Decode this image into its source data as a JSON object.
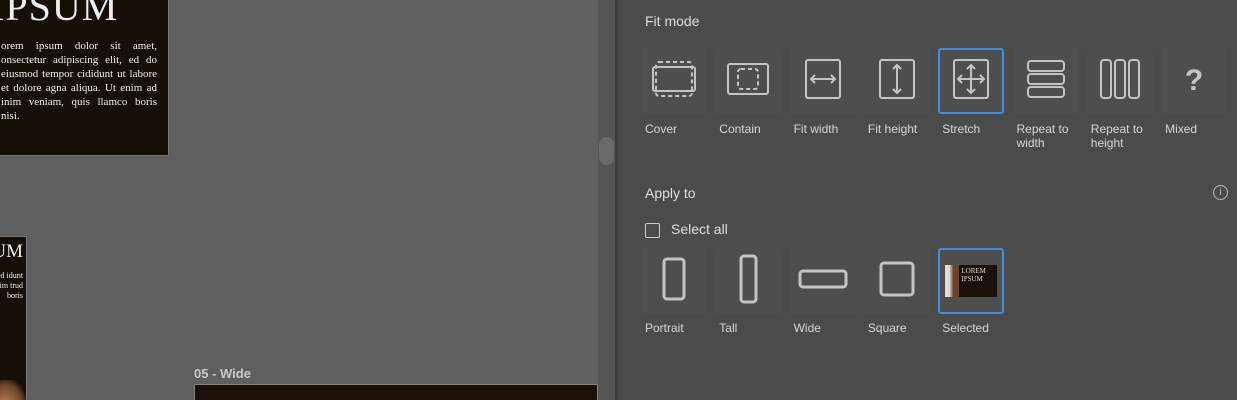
{
  "canvas": {
    "card1": {
      "title": "IPSUM",
      "body": "orem ipsum dolor sit amet, onsectetur adipiscing elit, ed do eiusmod tempor cididunt ut labore et dolore agna aliqua. Ut enim ad inim veniam, quis llamco boris nisi."
    },
    "card2": {
      "title": "UM",
      "body": "met, , sed idunt agna inim trud boris"
    },
    "wide_label": "05 - Wide"
  },
  "panel": {
    "fit_mode": {
      "heading": "Fit mode",
      "options": [
        {
          "label": "Cover",
          "icon": "cover-icon",
          "selected": false
        },
        {
          "label": "Contain",
          "icon": "contain-icon",
          "selected": false
        },
        {
          "label": "Fit width",
          "icon": "fit-width-icon",
          "selected": false
        },
        {
          "label": "Fit height",
          "icon": "fit-height-icon",
          "selected": false
        },
        {
          "label": "Stretch",
          "icon": "stretch-icon",
          "selected": true
        },
        {
          "label": "Repeat to width",
          "icon": "repeat-width-icon",
          "selected": false
        },
        {
          "label": "Repeat to height",
          "icon": "repeat-height-icon",
          "selected": false
        },
        {
          "label": "Mixed",
          "icon": "question-icon",
          "selected": false
        }
      ]
    },
    "apply_to": {
      "heading": "Apply to",
      "select_all": "Select all",
      "select_all_checked": false,
      "options": [
        {
          "label": "Portrait",
          "selected": false
        },
        {
          "label": "Tall",
          "selected": false
        },
        {
          "label": "Wide",
          "selected": false
        },
        {
          "label": "Square",
          "selected": false
        },
        {
          "label": "Selected",
          "selected": true
        }
      ],
      "thumb_text": "LOREM IPSUM"
    },
    "info_icon": "i"
  },
  "colors": {
    "accent": "#3d8fe0"
  }
}
